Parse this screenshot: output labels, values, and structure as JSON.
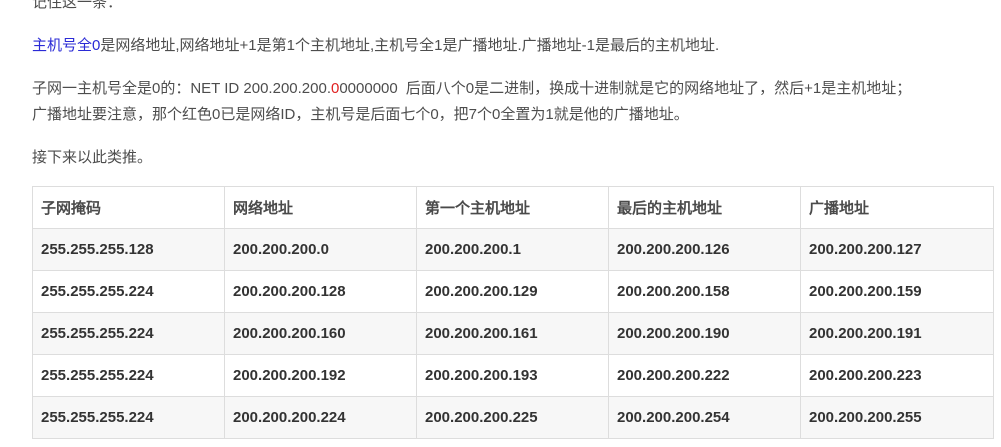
{
  "intro": "记住这一条：",
  "rule": {
    "highlight": "主机号全0",
    "rest": "是网络地址,网络地址+1是第1个主机地址,主机号全1是广播地址.广播地址-1是最后的主机地址."
  },
  "subnet_note": {
    "line1_prefix": "子网一主机号全是0的：NET ID  200.200.200.",
    "line1_red": "0",
    "line1_bits": "0000000",
    "line1_suffix": "后面八个0是二进制，换成十进制就是它的网络地址了，然后+1是主机地址；",
    "line2": "广播地址要注意，那个红色0已是网络ID，主机号是后面七个0，把7个0全置为1就是他的广播地址。"
  },
  "next": "接下来以此类推。",
  "table": {
    "headers": [
      "子网掩码",
      "网络地址",
      "第一个主机地址",
      "最后的主机地址",
      "广播地址"
    ],
    "rows": [
      [
        "255.255.255.128",
        "200.200.200.0",
        "200.200.200.1",
        "200.200.200.126",
        "200.200.200.127"
      ],
      [
        "255.255.255.224",
        "200.200.200.128",
        "200.200.200.129",
        "200.200.200.158",
        "200.200.200.159"
      ],
      [
        "255.255.255.224",
        "200.200.200.160",
        "200.200.200.161",
        "200.200.200.190",
        "200.200.200.191"
      ],
      [
        "255.255.255.224",
        "200.200.200.192",
        "200.200.200.193",
        "200.200.200.222",
        "200.200.200.223"
      ],
      [
        "255.255.255.224",
        "200.200.200.224",
        "200.200.200.225",
        "200.200.200.254",
        "200.200.200.255"
      ]
    ]
  },
  "colors": {
    "highlight_blue": "#2b2bd6",
    "highlight_red": "#e02020"
  }
}
